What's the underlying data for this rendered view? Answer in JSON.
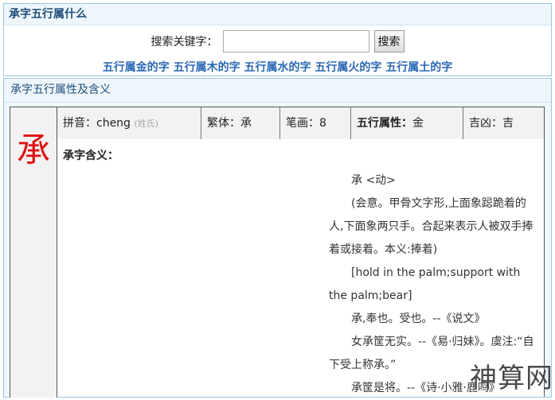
{
  "search_box": {
    "title": "承字五行属什么",
    "label": "搜索关键字：",
    "input_value": "",
    "button_label": "搜索",
    "links": [
      "五行属金的字",
      "五行属木的字",
      "五行属水的字",
      "五行属火的字",
      "五行属土的字"
    ]
  },
  "detail": {
    "title": "承字五行属性及含义",
    "character": "承",
    "pinyin_label": "拼音：",
    "pinyin": "cheng",
    "surname_tag": "(姓氏)",
    "traditional_label": "繁体：",
    "traditional": "承",
    "strokes_label": "笔画：",
    "strokes": "8",
    "element_label": "五行属性：",
    "element": "金",
    "luck_label": "吉凶：",
    "luck": "吉",
    "meaning_label": "承字含义：",
    "meaning_lines": [
      "承 <动>",
      "(会意。甲骨文字形,上面象跽跪着的人,下面象两只手。合起来表示人被双手捧着或接着。本义:捧着)",
      "[hold in the palm;support with the palm;bear]",
      "承,奉也。受也。--《说文》",
      "女承筐无实。--《易·归妹》。虞注:“自下受上称承。”",
      "承筐是将。--《诗·小雅·鹿鸣》"
    ]
  },
  "watermark": "神算网"
}
